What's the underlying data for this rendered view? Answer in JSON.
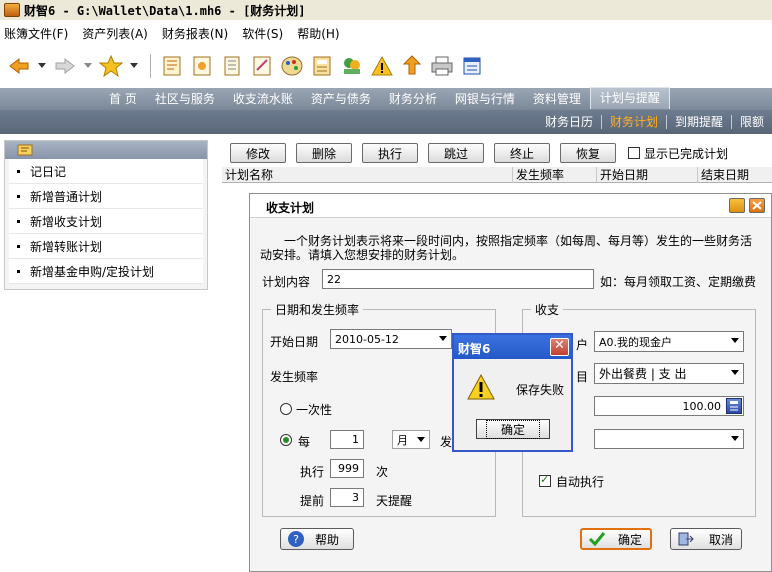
{
  "window": {
    "title": "财智6 - G:\\Wallet\\Data\\1.mh6 - [财务计划]"
  },
  "menu": [
    "账簿文件(F)",
    "资产列表(A)",
    "财务报表(N)",
    "软件(S)",
    "帮助(H)"
  ],
  "nav": {
    "tabs": [
      "首 页",
      "社区与服务",
      "收支流水账",
      "资产与债务",
      "财务分析",
      "网银与行情",
      "资料管理",
      "计划与提醒"
    ],
    "active": "计划与提醒"
  },
  "subnav": {
    "items": [
      "财务日历",
      "财务计划",
      "到期提醒",
      "限额"
    ],
    "active": "财务计划"
  },
  "sidebar": {
    "items": [
      "记日记",
      "新增普通计划",
      "新增收支计划",
      "新增转账计划",
      "新增基金申购/定投计划"
    ]
  },
  "actions": {
    "buttons": [
      "修改",
      "删除",
      "执行",
      "跳过",
      "终止",
      "恢复"
    ],
    "show_completed_label": "显示已完成计划"
  },
  "grid": {
    "columns": [
      "计划名称",
      "发生频率",
      "开始日期",
      "结束日期"
    ]
  },
  "dialog": {
    "title": "收支计划",
    "description": "一个财务计划表示将来一段时间内，按照指定频率（如每周、每月等）发生的一些财务活动安排。请填入您想安排的财务计划。",
    "content_label": "计划内容",
    "content_value": "22",
    "content_hint": "如：每月领取工资、定期缴费",
    "date_group_title": "日期和发生频率",
    "start_date_label": "开始日期",
    "start_date_value": "2010-05-12",
    "frequency_label": "发生频率",
    "once_label": "一次性",
    "every_label": "每",
    "every_value": "1",
    "period_value": "月",
    "occur_partial": "发",
    "execute_label": "执行",
    "execute_value": "999",
    "times_unit": "次",
    "advance_label": "提前",
    "advance_value": "3",
    "advance_unit": "天提醒",
    "income_group_title": "收支",
    "account_partial": "户",
    "account_value": "A0.我的现金户",
    "category_partial": "目",
    "category_value": "外出餐费 | 支 出",
    "amount_value": "100.00",
    "extra_value": "",
    "auto_execute_label": "自动执行",
    "help_label": "帮助",
    "ok_label": "确定",
    "cancel_label": "取消"
  },
  "message_box": {
    "title": "财智6",
    "message": "保存失败",
    "ok_label": "确定"
  }
}
